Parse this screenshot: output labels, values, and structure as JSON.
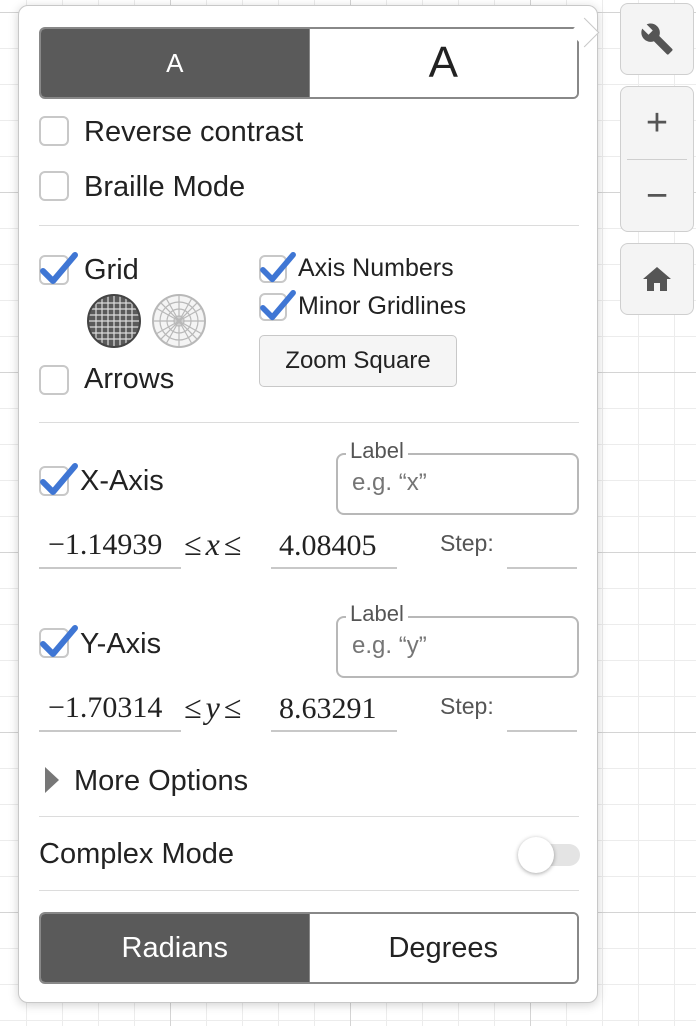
{
  "text_size": {
    "small_label": "A",
    "large_label": "A",
    "selected": "small"
  },
  "accessibility": {
    "reverse_contrast_label": "Reverse contrast",
    "braille_mode_label": "Braille Mode"
  },
  "grid": {
    "grid_label": "Grid",
    "arrows_label": "Arrows",
    "axis_numbers_label": "Axis Numbers",
    "minor_gridlines_label": "Minor Gridlines",
    "zoom_square_label": "Zoom Square"
  },
  "x_axis": {
    "label": "X-Axis",
    "field_legend": "Label",
    "field_placeholder": "e.g. “x”",
    "min": "−1.14939",
    "max": "4.08405",
    "var": "x",
    "leq": "≤",
    "step_label": "Step:"
  },
  "y_axis": {
    "label": "Y-Axis",
    "field_legend": "Label",
    "field_placeholder": "e.g. “y”",
    "min": "−1.70314",
    "max": "8.63291",
    "var": "y",
    "leq": "≤",
    "step_label": "Step:"
  },
  "more_options_label": "More Options",
  "complex_mode_label": "Complex Mode",
  "angle_mode": {
    "radians_label": "Radians",
    "degrees_label": "Degrees",
    "selected": "radians"
  },
  "zoom": {
    "in_symbol": "+",
    "out_symbol": "−"
  },
  "colors": {
    "accent": "#3f76d4",
    "active_segment": "#5a5a5a"
  }
}
